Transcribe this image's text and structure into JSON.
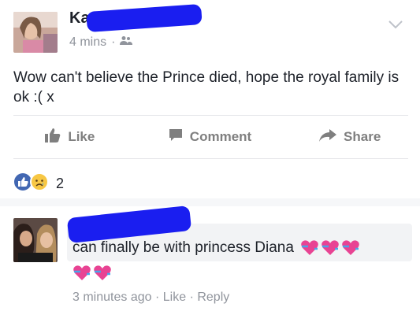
{
  "post": {
    "author": "Ka",
    "time": "4 mins",
    "separator": "·",
    "text": "Wow can't believe the Prince died, hope the royal family is ok :( x",
    "actions": [
      {
        "label": "Like",
        "icon": "thumbs-up-icon"
      },
      {
        "label": "Comment",
        "icon": "comment-icon"
      },
      {
        "label": "Share",
        "icon": "share-icon"
      }
    ],
    "reaction_count": "2"
  },
  "comment": {
    "text": "can finally be with princess Diana",
    "time": "3 minutes ago",
    "sep": "·",
    "like_label": "Like",
    "reply_label": "Reply"
  },
  "colors": {
    "redaction": "#1a1ef0",
    "meta_gray": "#90949c",
    "like_blue": "#4267b2",
    "heart_pink": "#e84393"
  }
}
